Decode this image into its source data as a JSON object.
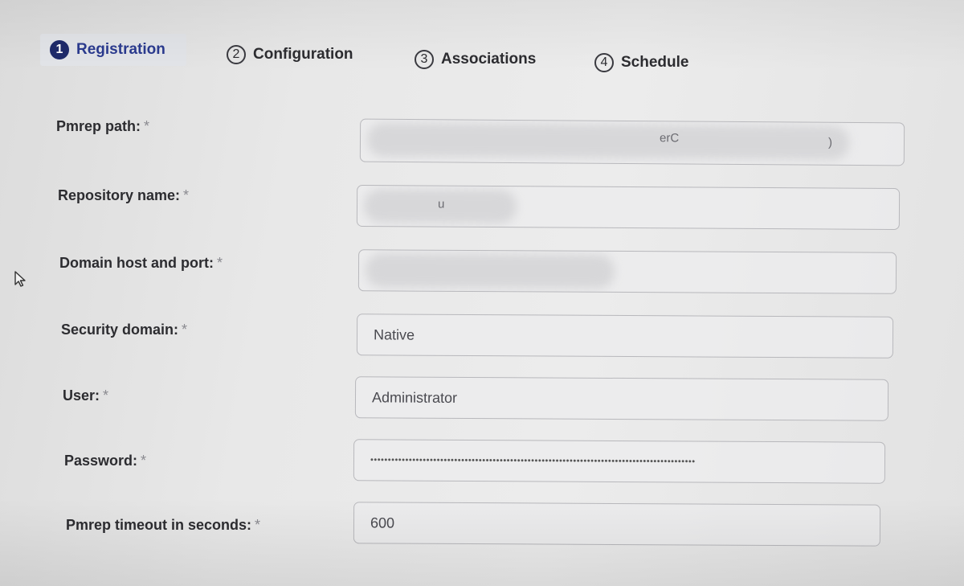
{
  "stepper": {
    "steps": [
      {
        "num": "1",
        "label": "Registration",
        "active": true
      },
      {
        "num": "2",
        "label": "Configuration",
        "active": false
      },
      {
        "num": "3",
        "label": "Associations",
        "active": false
      },
      {
        "num": "4",
        "label": "Schedule",
        "active": false
      }
    ]
  },
  "form": {
    "required_marker": "*",
    "pmrep_path": {
      "label": "Pmrep path:",
      "suffix_fragment": "erC",
      "end_fragment": ")"
    },
    "repository_name": {
      "label": "Repository name:",
      "fragment": "u"
    },
    "domain_host_port": {
      "label": "Domain host and port:"
    },
    "security_domain": {
      "label": "Security domain:",
      "value": "Native"
    },
    "user": {
      "label": "User:",
      "value": "Administrator"
    },
    "password": {
      "label": "Password:",
      "value": "•••••••••••••••••••••••••••••••••••••••••••••••••••••••••••••••••••••••••••••••••••••••••••••"
    },
    "pmrep_timeout": {
      "label": "Pmrep timeout in seconds:",
      "value": "600"
    }
  }
}
